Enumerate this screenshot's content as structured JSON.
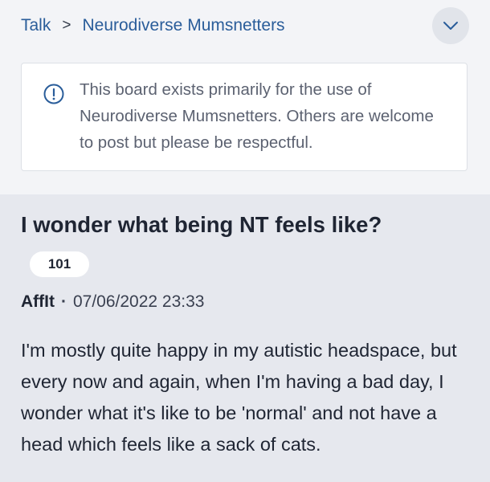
{
  "breadcrumb": {
    "root": "Talk",
    "separator": ">",
    "board": "Neurodiverse Mumsnetters"
  },
  "notice": {
    "icon": "info-icon",
    "text": "This board exists primarily for the use of Neurodiverse Mumsnetters. Others are welcome to post but please be respectful."
  },
  "thread": {
    "title": "I wonder what being NT feels like?",
    "reply_count": "101"
  },
  "post": {
    "author": "AffIt",
    "separator": "·",
    "timestamp": "07/06/2022 23:33",
    "body": "I'm mostly quite happy in my autistic headspace, but every now and again, when I'm having a bad day, I wonder what it's like to be 'normal' and not have a head which feels like a sack of cats."
  },
  "colors": {
    "link": "#2a5d9a",
    "top_background": "#f3f4f7",
    "thread_background": "#e6e8ee"
  }
}
